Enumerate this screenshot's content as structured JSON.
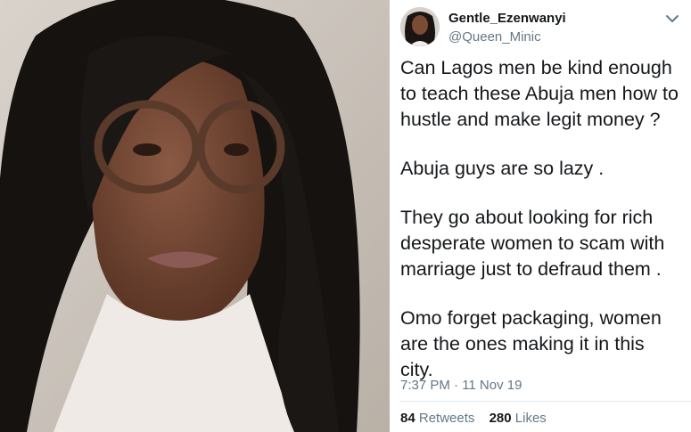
{
  "tweet": {
    "display_name": "Gentle_Ezenwanyi",
    "handle": "@Queen_Minic",
    "paragraphs": [
      [
        "Can Lagos men  be kind enough",
        "to teach these Abuja men how to",
        "hustle and make legit money ?"
      ],
      [
        "Abuja guys are so lazy ."
      ],
      [
        "They go about looking for rich",
        "desperate women to scam with",
        "marriage just to defraud them ."
      ],
      [
        "Omo forget packaging, women",
        "are the ones making it in this",
        "city."
      ]
    ],
    "timestamp": "7:37 PM · 11 Nov 19",
    "retweets_count": "84",
    "retweets_label": "Retweets",
    "likes_count": "280",
    "likes_label": "Likes",
    "menu_icon": "chevron-down-icon"
  },
  "colors": {
    "text_primary": "#14171a",
    "text_secondary": "#657786",
    "divider": "#e1e8ed"
  }
}
